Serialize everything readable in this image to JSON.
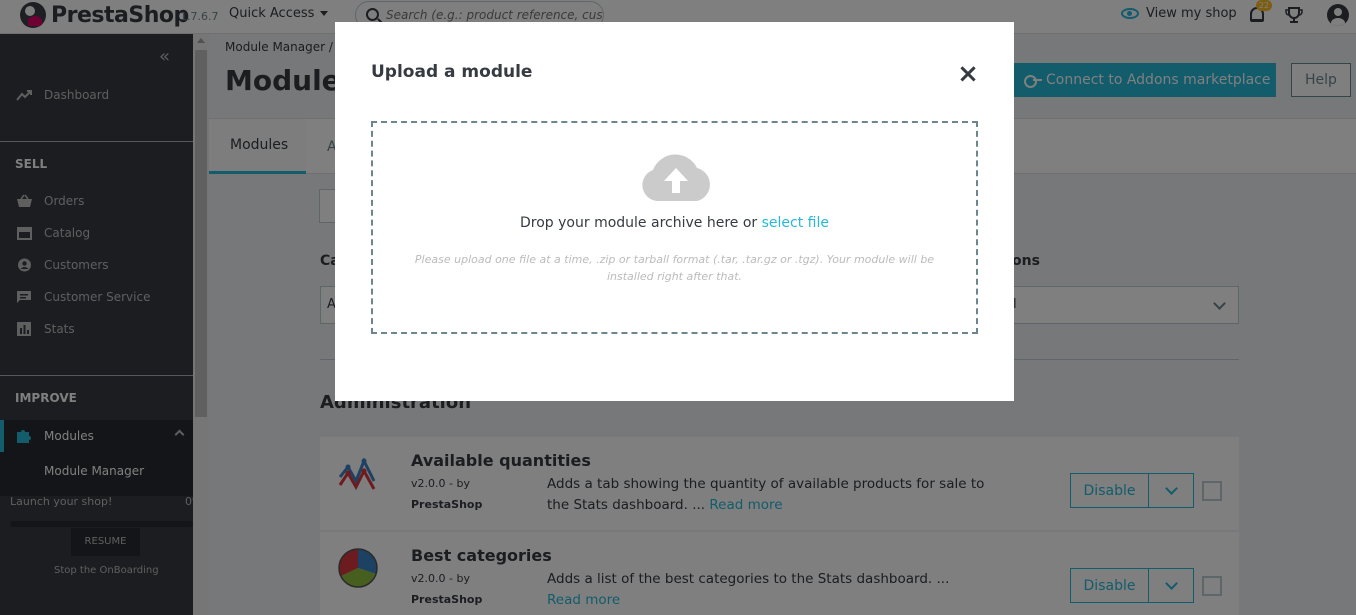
{
  "header": {
    "logo_text": "PrestaShop",
    "version": "1.7.6.7",
    "quick_access": "Quick Access",
    "search_placeholder": "Search (e.g.: product reference, custome",
    "view_shop": "View my shop",
    "notifications_count": "22"
  },
  "sidebar": {
    "dashboard": "Dashboard",
    "sell_section": "SELL",
    "sell_items": [
      "Orders",
      "Catalog",
      "Customers",
      "Customer Service",
      "Stats"
    ],
    "improve_section": "IMPROVE",
    "modules": "Modules",
    "module_manager": "Module Manager",
    "launch_text": "Launch your shop!",
    "launch_pct": "0%",
    "resume": "RESUME",
    "stop_onboarding": "Stop the OnBoarding"
  },
  "page": {
    "breadcrumb": "Module Manager  /",
    "title": "Module manager",
    "connect_btn": "Connect to Addons marketplace",
    "help_btn": "Help",
    "tabs": [
      "Modules",
      "A"
    ],
    "category_label": "Ca",
    "category_value": "A",
    "sort_label": "ons",
    "sort_value": "l",
    "section_title": "Administration"
  },
  "modules": [
    {
      "name": "Available quantities",
      "version": "v2.0.0 - by",
      "author": "PrestaShop",
      "description": "Adds a tab showing the quantity of available products for sale to the Stats dashboard. ...",
      "read_more": "Read more",
      "action": "Disable"
    },
    {
      "name": "Best categories",
      "version": "v2.0.0 - by",
      "author": "PrestaShop",
      "description": "Adds a list of the best categories to the Stats dashboard. ...",
      "read_more": "Read more",
      "action": "Disable"
    }
  ],
  "modal": {
    "title": "Upload a module",
    "close": "×",
    "drop_text": "Drop your module archive here or",
    "select_file": "select file",
    "hint": "Please upload one file at a time, .zip or tarball format (.tar, .tar.gz or .tgz). Your module will be installed right after that."
  },
  "colors": {
    "accent": "#25b9d7",
    "sidebar_bg": "#363a41",
    "text": "#363a41"
  }
}
